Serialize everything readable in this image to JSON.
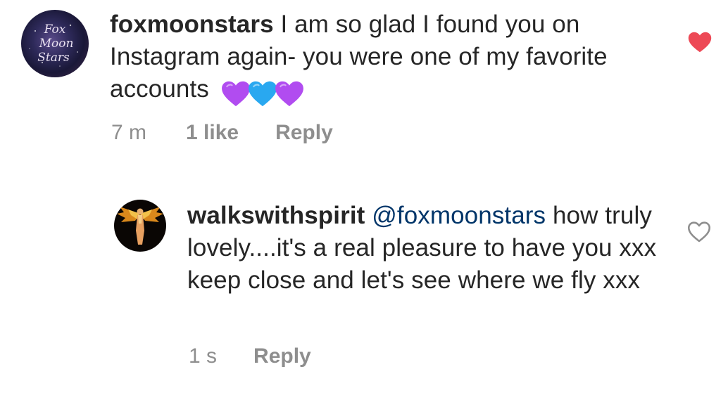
{
  "comments": [
    {
      "username": "foxmoonstars",
      "text": " I am so glad I found you on Instagram again- you were one of my favorite accounts ",
      "emoji": [
        "purple-heart",
        "blue-heart",
        "purple-heart"
      ],
      "time": "7 m",
      "likes": "1 like",
      "reply_label": "Reply",
      "liked": true,
      "avatar_text": [
        "Fox",
        "Moon",
        "Stars"
      ]
    },
    {
      "username": "walkswithspirit",
      "mention": "@foxmoonstars",
      "text": " how truly lovely....it's a real pleasure to have you xxx keep close and let's see where we fly xxx",
      "time": "1 s",
      "reply_label": "Reply",
      "liked": false
    }
  ],
  "colors": {
    "username": "#262626",
    "mention": "#003569",
    "meta": "#8e8e8e",
    "liked_heart": "#ed4956",
    "outline_heart": "#8e8e8e",
    "purple_heart": "#b14cf0",
    "blue_heart": "#29a8f0"
  },
  "icons": {
    "liked": "heart-filled-icon",
    "not_liked": "heart-outline-icon"
  }
}
